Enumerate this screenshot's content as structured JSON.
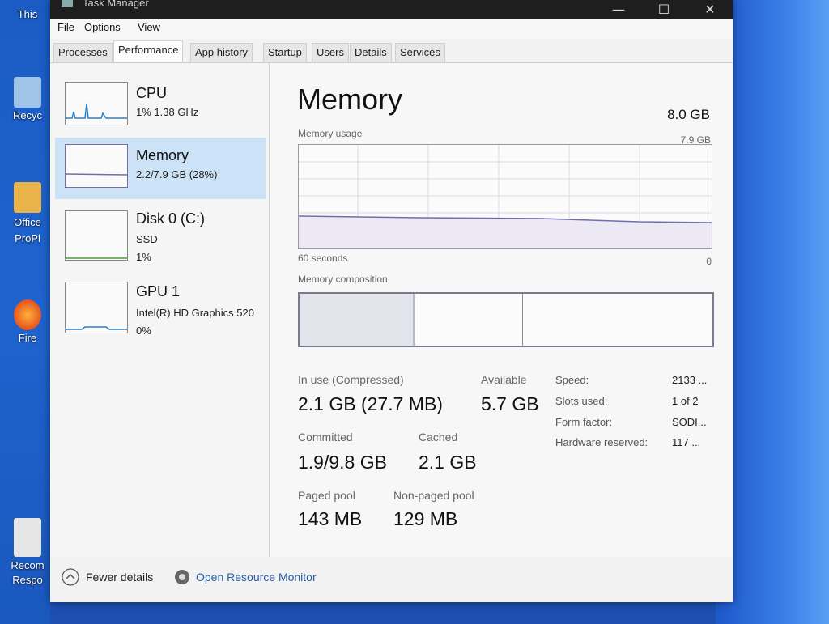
{
  "window": {
    "title": "Task Manager",
    "minimize_glyph": "—",
    "maximize_glyph": "☐",
    "close_glyph": "✕"
  },
  "menu": [
    "File",
    "Options",
    "View"
  ],
  "tabs": [
    "Processes",
    "Performance",
    "App history",
    "Startup",
    "Users",
    "Details",
    "Services"
  ],
  "active_tab": "Performance",
  "sidebar": {
    "cpu": {
      "title": "CPU",
      "sub": "1%  1.38 GHz"
    },
    "memory": {
      "title": "Memory",
      "sub": "2.2/7.9 GB (28%)"
    },
    "disk": {
      "title": "Disk 0 (C:)",
      "sub1": "SSD",
      "sub2": "1%"
    },
    "gpu": {
      "title": "GPU 1",
      "sub1": "Intel(R) HD Graphics 520",
      "sub2": "0%"
    }
  },
  "main": {
    "title": "Memory",
    "total": "8.0 GB",
    "usage_label": "Memory usage",
    "usage_max": "7.9 GB",
    "x_label_left": "60 seconds",
    "x_label_right": "0",
    "composition_label": "Memory composition",
    "in_use_label": "In use (Compressed)",
    "in_use_value": "2.1 GB (27.7 MB)",
    "available_label": "Available",
    "available_value": "5.7 GB",
    "committed_label": "Committed",
    "committed_value": "1.9/9.8 GB",
    "cached_label": "Cached",
    "cached_value": "2.1 GB",
    "paged_label": "Paged pool",
    "paged_value": "143 MB",
    "nonpaged_label": "Non-paged pool",
    "nonpaged_value": "129 MB",
    "speed_label": "Speed:",
    "speed_value": "2133 ...",
    "slots_label": "Slots used:",
    "slots_value": "1 of 2",
    "form_label": "Form factor:",
    "form_value": "SODI...",
    "hw_label": "Hardware reserved:",
    "hw_value": "117 ..."
  },
  "footer": {
    "fewer_details": "Fewer details",
    "resource_monitor": "Open Resource Monitor"
  },
  "desktop_icons": [
    {
      "label": "This",
      "icon": "this-pc-icon"
    },
    {
      "label": "Recyc",
      "icon": "recycle-bin-icon"
    },
    {
      "label": "Office ProPl",
      "icon": "office-icon"
    },
    {
      "label": "Fire",
      "icon": "firefox-icon"
    },
    {
      "label": "Recom Respo",
      "icon": "document-icon"
    }
  ],
  "colors": {
    "accent_selected": "#cce3f7",
    "graph_line": "#6b6fb0",
    "link": "#2a5fa8"
  }
}
